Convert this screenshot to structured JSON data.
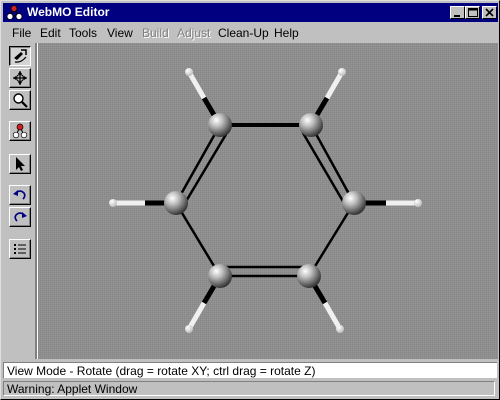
{
  "window": {
    "title": "WebMO Editor"
  },
  "menu": [
    {
      "label": "File",
      "enabled": true
    },
    {
      "label": "Edit",
      "enabled": true
    },
    {
      "label": "Tools",
      "enabled": true
    },
    {
      "label": "View",
      "enabled": true
    },
    {
      "label": "Build",
      "enabled": false
    },
    {
      "label": "Adjust",
      "enabled": false
    },
    {
      "label": "Clean-Up",
      "enabled": true
    },
    {
      "label": "Help",
      "enabled": true
    }
  ],
  "toolbar": [
    {
      "name": "rotate-tool",
      "icon": "rotate-icon",
      "pressed": true
    },
    {
      "name": "translate-tool",
      "icon": "move-icon",
      "pressed": false
    },
    {
      "name": "zoom-tool",
      "icon": "magnifier-icon",
      "pressed": false
    },
    {
      "name": "build-tool",
      "icon": "atoms-icon",
      "pressed": false
    },
    {
      "name": "select-tool",
      "icon": "arrow-cursor-icon",
      "pressed": false
    },
    {
      "name": "undo-tool",
      "icon": "undo-icon",
      "pressed": false
    },
    {
      "name": "redo-tool",
      "icon": "redo-icon",
      "pressed": false
    },
    {
      "name": "list-tool",
      "icon": "list-icon",
      "pressed": false
    }
  ],
  "molecule": {
    "name_hidden": true,
    "carbon_color": "#9a9a9a",
    "hydrogen_color": "#f2f2f2",
    "bond_color": "#000000"
  },
  "status": {
    "text": "View Mode - Rotate (drag = rotate XY; ctrl drag = rotate Z)"
  },
  "warning": {
    "text": "Warning: Applet Window"
  },
  "colors": {
    "titlebar": "#000080",
    "window_face": "#c0c0c0",
    "canvas": "#8e8e8e"
  }
}
